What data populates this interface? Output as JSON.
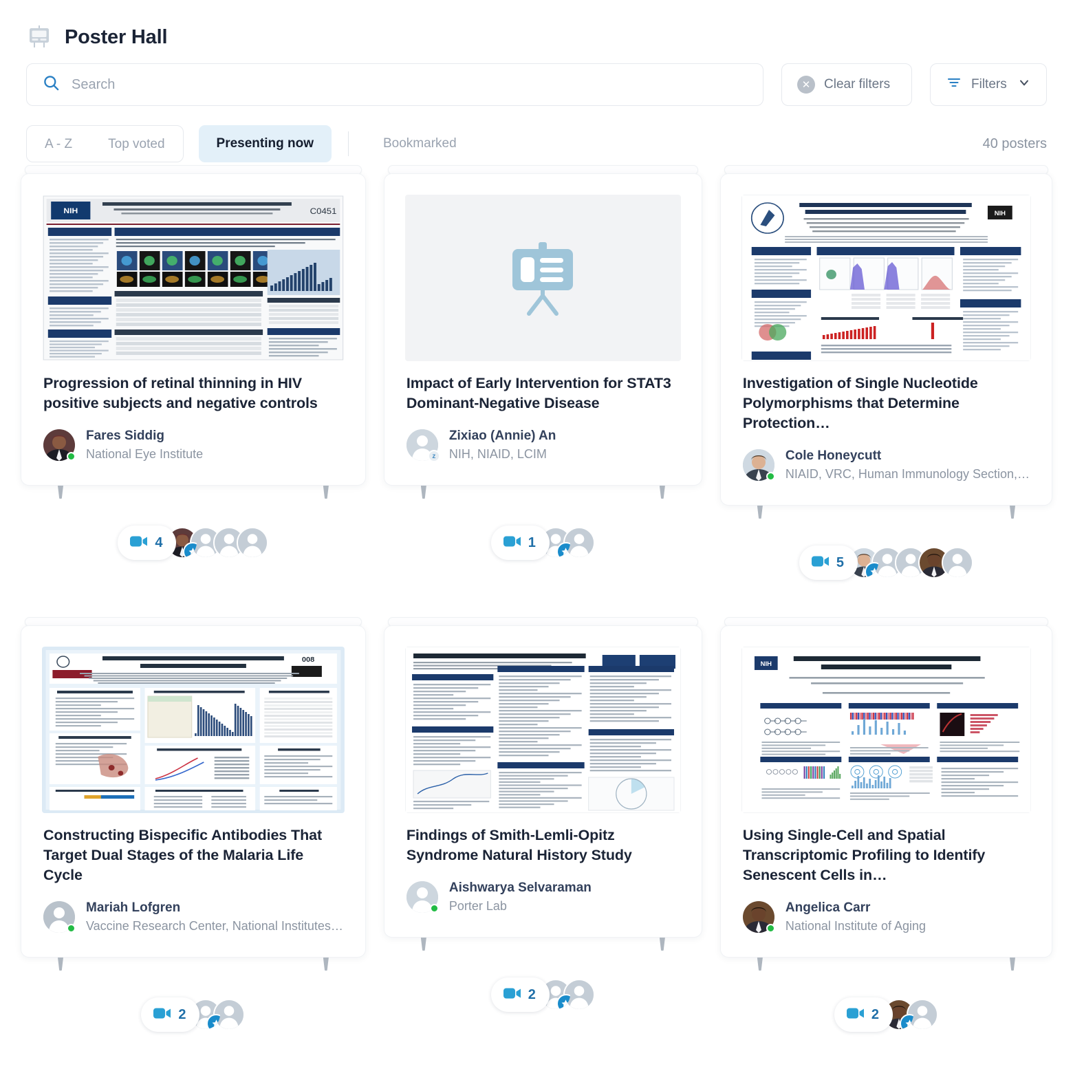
{
  "header": {
    "title": "Poster Hall",
    "icon": "presentation-board-icon"
  },
  "search": {
    "placeholder": "Search",
    "value": "",
    "icon": "search-icon"
  },
  "toolbar": {
    "clear_filters_label": "Clear filters",
    "clear_filters_icon": "close-circle-icon",
    "filters_label": "Filters",
    "filters_icon": "filter-lines-icon",
    "filters_chevron_icon": "chevron-down-icon"
  },
  "tabs": [
    {
      "label": "A - Z",
      "active": false,
      "group": "segmented"
    },
    {
      "label": "Top voted",
      "active": false,
      "group": "segmented"
    },
    {
      "label": "Presenting now",
      "active": true,
      "group": "standalone"
    },
    {
      "label": "Bookmarked",
      "active": false,
      "group": "standalone"
    }
  ],
  "poster_count": "40 posters",
  "colors": {
    "accent_blue": "#1a8ccb",
    "active_tab_bg": "#e3f0f9",
    "online_green": "#22bb44",
    "muted_text": "#8b94a1",
    "title_text": "#1b2436"
  },
  "posters": [
    {
      "title": "Progression of retinal thinning in HIV positive subjects and negative controls",
      "thumbnail": "poster-retinal-thinning",
      "author": "Fares Siddig",
      "affiliation": "National Eye Institute",
      "status": "online",
      "avatar": "photo-avatar",
      "presence": {
        "video_count": "4",
        "avatar_slots": 4,
        "photo_slots": [
          0
        ],
        "starred_slot": 0
      }
    },
    {
      "title": "Impact of Early Intervention for STAT3 Dominant-Negative Disease",
      "thumbnail": "placeholder-board-icon",
      "author": "Zixiao (Annie) An",
      "affiliation": "NIH, NIAID, LCIM",
      "status": "away",
      "status_glyph": "z",
      "avatar": "default-avatar",
      "presence": {
        "video_count": "1",
        "avatar_slots": 2,
        "photo_slots": [],
        "starred_slot": 0
      }
    },
    {
      "title": "Investigation of Single Nucleotide Polymorphisms that Determine Protection…",
      "thumbnail": "poster-snp-hiv",
      "author": "Cole Honeycutt",
      "affiliation": "NIAID, VRC, Human Immunology Section,…",
      "status": "online",
      "avatar": "photo-avatar",
      "presence": {
        "video_count": "5",
        "avatar_slots": 5,
        "photo_slots": [
          0,
          3
        ],
        "starred_slot": 0
      }
    },
    {
      "title": "Constructing Bispecific Antibodies That Target Dual Stages of the Malaria Life Cycle",
      "thumbnail": "poster-bispecific-antibodies",
      "author": "Mariah Lofgren",
      "affiliation": "Vaccine Research Center, National Institutes…",
      "status": "online",
      "avatar": "default-avatar",
      "presence": {
        "video_count": "2",
        "avatar_slots": 2,
        "photo_slots": [],
        "starred_slot": 0
      }
    },
    {
      "title": "Findings of Smith-Lemli-Opitz Syndrome Natural History Study",
      "thumbnail": "poster-slos-mortality",
      "author": "Aishwarya Selvaraman",
      "affiliation": "Porter Lab",
      "status": "online",
      "avatar": "default-avatar",
      "presence": {
        "video_count": "2",
        "avatar_slots": 2,
        "photo_slots": [],
        "starred_slot": 0
      }
    },
    {
      "title": "Using Single-Cell and Spatial Transcriptomic Profiling to Identify Senescent Cells in…",
      "thumbnail": "poster-senescent-cells",
      "author": "Angelica Carr",
      "affiliation": "National Institute of Aging",
      "status": "online",
      "avatar": "photo-avatar",
      "presence": {
        "video_count": "2",
        "avatar_slots": 2,
        "photo_slots": [
          0
        ],
        "starred_slot": 0
      }
    }
  ]
}
